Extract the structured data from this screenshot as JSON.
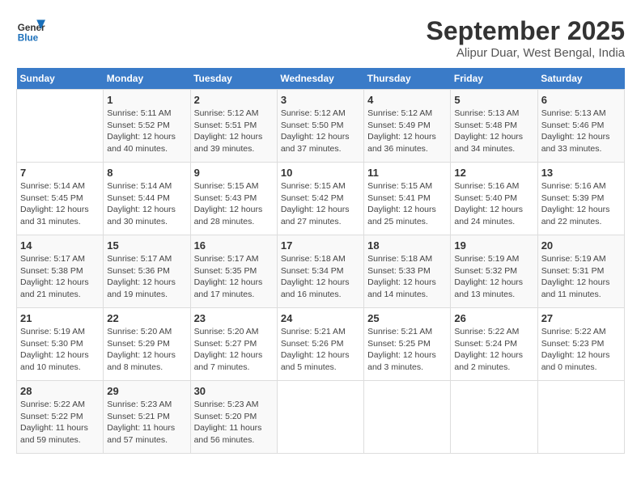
{
  "header": {
    "logo_line1": "General",
    "logo_line2": "Blue",
    "month": "September 2025",
    "location": "Alipur Duar, West Bengal, India"
  },
  "weekdays": [
    "Sunday",
    "Monday",
    "Tuesday",
    "Wednesday",
    "Thursday",
    "Friday",
    "Saturday"
  ],
  "weeks": [
    [
      {
        "day": "",
        "info": ""
      },
      {
        "day": "1",
        "info": "Sunrise: 5:11 AM\nSunset: 5:52 PM\nDaylight: 12 hours\nand 40 minutes."
      },
      {
        "day": "2",
        "info": "Sunrise: 5:12 AM\nSunset: 5:51 PM\nDaylight: 12 hours\nand 39 minutes."
      },
      {
        "day": "3",
        "info": "Sunrise: 5:12 AM\nSunset: 5:50 PM\nDaylight: 12 hours\nand 37 minutes."
      },
      {
        "day": "4",
        "info": "Sunrise: 5:12 AM\nSunset: 5:49 PM\nDaylight: 12 hours\nand 36 minutes."
      },
      {
        "day": "5",
        "info": "Sunrise: 5:13 AM\nSunset: 5:48 PM\nDaylight: 12 hours\nand 34 minutes."
      },
      {
        "day": "6",
        "info": "Sunrise: 5:13 AM\nSunset: 5:46 PM\nDaylight: 12 hours\nand 33 minutes."
      }
    ],
    [
      {
        "day": "7",
        "info": "Sunrise: 5:14 AM\nSunset: 5:45 PM\nDaylight: 12 hours\nand 31 minutes."
      },
      {
        "day": "8",
        "info": "Sunrise: 5:14 AM\nSunset: 5:44 PM\nDaylight: 12 hours\nand 30 minutes."
      },
      {
        "day": "9",
        "info": "Sunrise: 5:15 AM\nSunset: 5:43 PM\nDaylight: 12 hours\nand 28 minutes."
      },
      {
        "day": "10",
        "info": "Sunrise: 5:15 AM\nSunset: 5:42 PM\nDaylight: 12 hours\nand 27 minutes."
      },
      {
        "day": "11",
        "info": "Sunrise: 5:15 AM\nSunset: 5:41 PM\nDaylight: 12 hours\nand 25 minutes."
      },
      {
        "day": "12",
        "info": "Sunrise: 5:16 AM\nSunset: 5:40 PM\nDaylight: 12 hours\nand 24 minutes."
      },
      {
        "day": "13",
        "info": "Sunrise: 5:16 AM\nSunset: 5:39 PM\nDaylight: 12 hours\nand 22 minutes."
      }
    ],
    [
      {
        "day": "14",
        "info": "Sunrise: 5:17 AM\nSunset: 5:38 PM\nDaylight: 12 hours\nand 21 minutes."
      },
      {
        "day": "15",
        "info": "Sunrise: 5:17 AM\nSunset: 5:36 PM\nDaylight: 12 hours\nand 19 minutes."
      },
      {
        "day": "16",
        "info": "Sunrise: 5:17 AM\nSunset: 5:35 PM\nDaylight: 12 hours\nand 17 minutes."
      },
      {
        "day": "17",
        "info": "Sunrise: 5:18 AM\nSunset: 5:34 PM\nDaylight: 12 hours\nand 16 minutes."
      },
      {
        "day": "18",
        "info": "Sunrise: 5:18 AM\nSunset: 5:33 PM\nDaylight: 12 hours\nand 14 minutes."
      },
      {
        "day": "19",
        "info": "Sunrise: 5:19 AM\nSunset: 5:32 PM\nDaylight: 12 hours\nand 13 minutes."
      },
      {
        "day": "20",
        "info": "Sunrise: 5:19 AM\nSunset: 5:31 PM\nDaylight: 12 hours\nand 11 minutes."
      }
    ],
    [
      {
        "day": "21",
        "info": "Sunrise: 5:19 AM\nSunset: 5:30 PM\nDaylight: 12 hours\nand 10 minutes."
      },
      {
        "day": "22",
        "info": "Sunrise: 5:20 AM\nSunset: 5:29 PM\nDaylight: 12 hours\nand 8 minutes."
      },
      {
        "day": "23",
        "info": "Sunrise: 5:20 AM\nSunset: 5:27 PM\nDaylight: 12 hours\nand 7 minutes."
      },
      {
        "day": "24",
        "info": "Sunrise: 5:21 AM\nSunset: 5:26 PM\nDaylight: 12 hours\nand 5 minutes."
      },
      {
        "day": "25",
        "info": "Sunrise: 5:21 AM\nSunset: 5:25 PM\nDaylight: 12 hours\nand 3 minutes."
      },
      {
        "day": "26",
        "info": "Sunrise: 5:22 AM\nSunset: 5:24 PM\nDaylight: 12 hours\nand 2 minutes."
      },
      {
        "day": "27",
        "info": "Sunrise: 5:22 AM\nSunset: 5:23 PM\nDaylight: 12 hours\nand 0 minutes."
      }
    ],
    [
      {
        "day": "28",
        "info": "Sunrise: 5:22 AM\nSunset: 5:22 PM\nDaylight: 11 hours\nand 59 minutes."
      },
      {
        "day": "29",
        "info": "Sunrise: 5:23 AM\nSunset: 5:21 PM\nDaylight: 11 hours\nand 57 minutes."
      },
      {
        "day": "30",
        "info": "Sunrise: 5:23 AM\nSunset: 5:20 PM\nDaylight: 11 hours\nand 56 minutes."
      },
      {
        "day": "",
        "info": ""
      },
      {
        "day": "",
        "info": ""
      },
      {
        "day": "",
        "info": ""
      },
      {
        "day": "",
        "info": ""
      }
    ]
  ]
}
